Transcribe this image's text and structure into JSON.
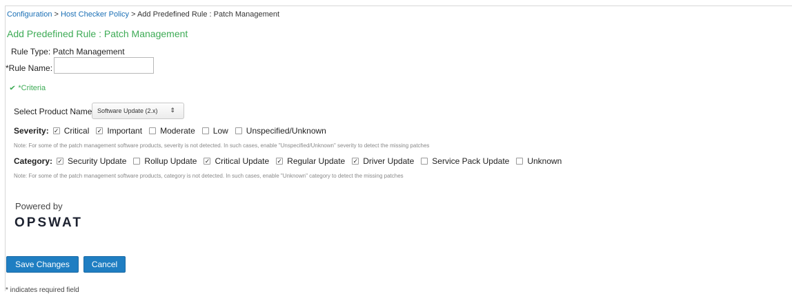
{
  "breadcrumb": {
    "item1": "Configuration",
    "sep": " > ",
    "item2": "Host Checker Policy",
    "item3": "Add Predefined Rule : Patch Management"
  },
  "title": "Add Predefined Rule : Patch Management",
  "rule_type": "Rule Type:  Patch Management",
  "rule_name_label": "*Rule Name:",
  "rule_name_value": "",
  "criteria_label": "*Criteria",
  "product": {
    "label": "Select Product Name:",
    "selected": "Software Update (2.x)"
  },
  "severity": {
    "label": "Severity:",
    "options": [
      {
        "label": "Critical",
        "checked": true
      },
      {
        "label": "Important",
        "checked": true
      },
      {
        "label": "Moderate",
        "checked": false
      },
      {
        "label": "Low",
        "checked": false
      },
      {
        "label": "Unspecified/Unknown",
        "checked": false
      }
    ],
    "note": "Note: For some of the patch management software products, severity is not detected. In such cases, enable \"Unspecified/Unknown\" severity to detect the missing patches"
  },
  "category": {
    "label": "Category:",
    "options": [
      {
        "label": "Security Update",
        "checked": true
      },
      {
        "label": "Rollup Update",
        "checked": false
      },
      {
        "label": "Critical Update",
        "checked": true
      },
      {
        "label": "Regular Update",
        "checked": true
      },
      {
        "label": "Driver Update",
        "checked": true
      },
      {
        "label": "Service Pack Update",
        "checked": false
      },
      {
        "label": "Unknown",
        "checked": false
      }
    ],
    "note": "Note: For some of the patch management software products, category is not detected. In such cases, enable \"Unknown\" category to detect the missing patches"
  },
  "powered_by": "Powered by",
  "logo_text": "OPSWAT",
  "buttons": {
    "save": "Save Changes",
    "cancel": "Cancel"
  },
  "required_note": "* indicates required field",
  "colors": {
    "accent_green": "#3dab55",
    "link_blue": "#1a6fb5",
    "button_blue": "#1f7ec2"
  }
}
